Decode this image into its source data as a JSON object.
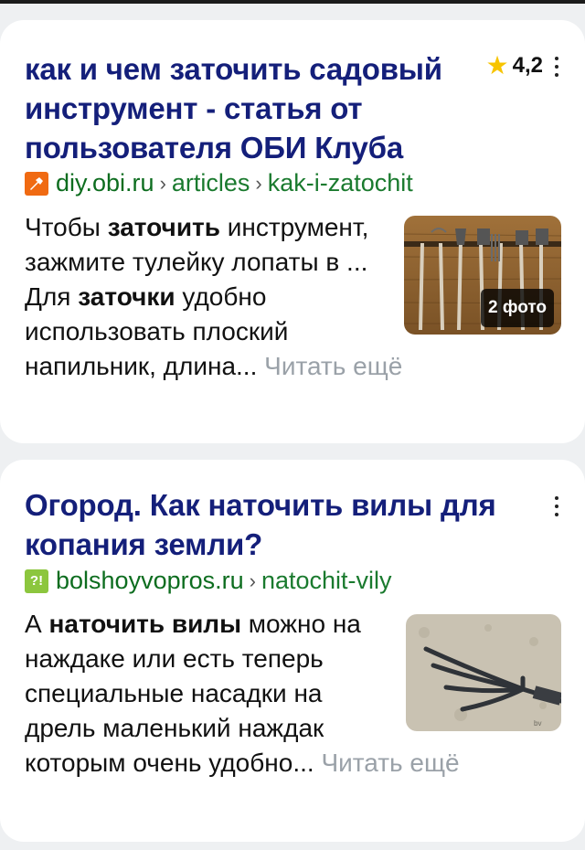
{
  "results": [
    {
      "title": "как и чем заточить садовый инструмент - статья от пользователя ОБИ Клуба",
      "rating": "4,2",
      "domain": "diy.obi.ru",
      "path1": "articles",
      "path2": "kak-i-zatochit",
      "snippet_parts": [
        "Чтобы ",
        "заточить",
        " инструмент, зажмите тулейку лопаты в ... Для ",
        "заточки",
        " удобно использовать плоский напильник, длина... "
      ],
      "read_more": "Читать ещё",
      "photo_badge": "2 фото",
      "favicon_icon": "obi-favicon-icon"
    },
    {
      "title": "Огород. Как наточить вилы для копания земли?",
      "domain": "bolshoyvopros.ru",
      "path1": "natochit-vily",
      "snippet_parts": [
        "А ",
        "наточить вилы",
        " можно на наждаке или есть теперь специальные насадки на дрель маленький наждак которым очень удобно... "
      ],
      "read_more": "Читать ещё",
      "favicon_icon": "bolshoyvopros-favicon-icon",
      "favicon_text": "?!"
    }
  ],
  "colors": {
    "title": "#141f7a",
    "url": "#0d6d1f",
    "read_more": "#9aa1a8",
    "star": "#f7c400"
  }
}
